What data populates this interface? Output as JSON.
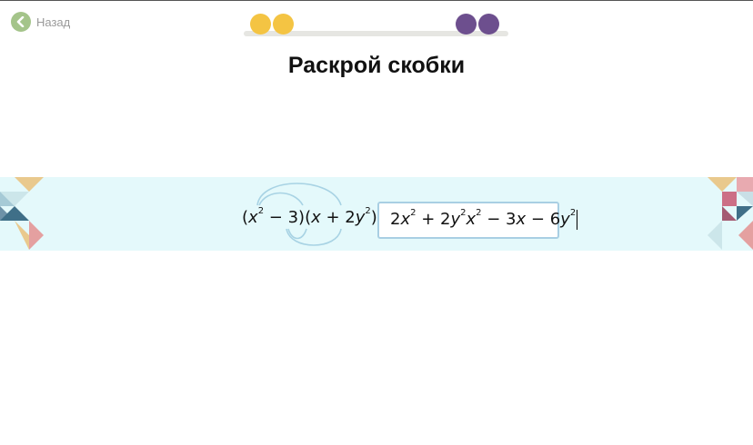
{
  "nav": {
    "back_label": "Назад"
  },
  "progress": {
    "colors": {
      "done": "#f4c443",
      "remaining": "#6d4f8e"
    }
  },
  "task": {
    "title": "Раскрой скобки",
    "lhs": {
      "open1": "(",
      "a": "x",
      "a_exp": "2",
      "op1": " − 3)",
      "open2": "(",
      "b": "x",
      "op2": " + 2",
      "c": "y",
      "c_exp": "2",
      "close2": ")",
      "eq": " ="
    },
    "answer": {
      "t1_coef": "2",
      "t1_var": "x",
      "t1_exp": "2",
      "t2": " + 2",
      "t2_var1": "y",
      "t2_exp1": "2",
      "t2_var2": "x",
      "t2_exp2": "2",
      "t3": " − 3",
      "t3_var": "x",
      "t4": " − 6",
      "t4_var": "y",
      "t4_exp": "2"
    }
  },
  "colors": {
    "band": "#e4f9fb",
    "arc": "#a8d3e4",
    "input_border": "#a9cfe3",
    "back_button": "#a4c48a"
  }
}
